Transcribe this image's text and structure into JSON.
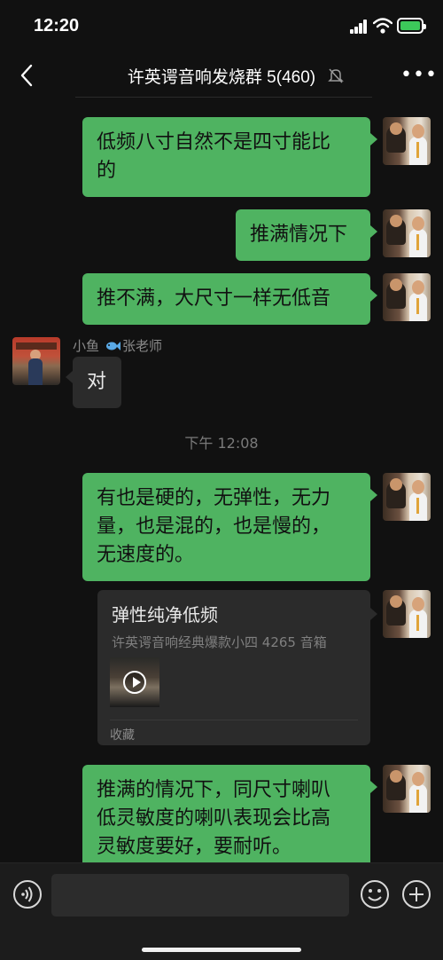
{
  "status_bar": {
    "time": "12:20"
  },
  "header": {
    "title": "许英谔音响发烧群 5(460)"
  },
  "chat": {
    "messages": [
      {
        "lines": [
          "低频八寸自然不是四寸能比",
          "的"
        ]
      },
      {
        "lines": [
          "推满情况下"
        ]
      },
      {
        "lines": [
          "推不满，大尺寸一样无低音"
        ]
      },
      {
        "sender_name": "小鱼",
        "sender_remark": "张老师",
        "lines": [
          "对"
        ]
      },
      {
        "lines": [
          "有也是硬的，无弹性，无力",
          "量，也是混的，也是慢的，",
          "无速度的。"
        ]
      },
      {
        "lines": [
          "推满的情况下，同尺寸喇叭",
          "低灵敏度的喇叭表现会比高",
          "灵敏度要好，要耐听。"
        ]
      }
    ],
    "timestamp": "下午 12:08",
    "card": {
      "title": "弹性纯净低频",
      "subtitle": "许英谔音响经典爆款小四 4265 音箱",
      "footer": "收藏"
    }
  },
  "colors": {
    "outgoing_bubble": "#4fb361",
    "incoming_bubble": "#2b2b2b",
    "background": "#111111"
  },
  "icons": [
    "back-arrow-icon",
    "mute-bell-icon",
    "more-icon",
    "voice-icon",
    "emoji-icon",
    "plus-icon",
    "play-icon",
    "fish-icon"
  ]
}
